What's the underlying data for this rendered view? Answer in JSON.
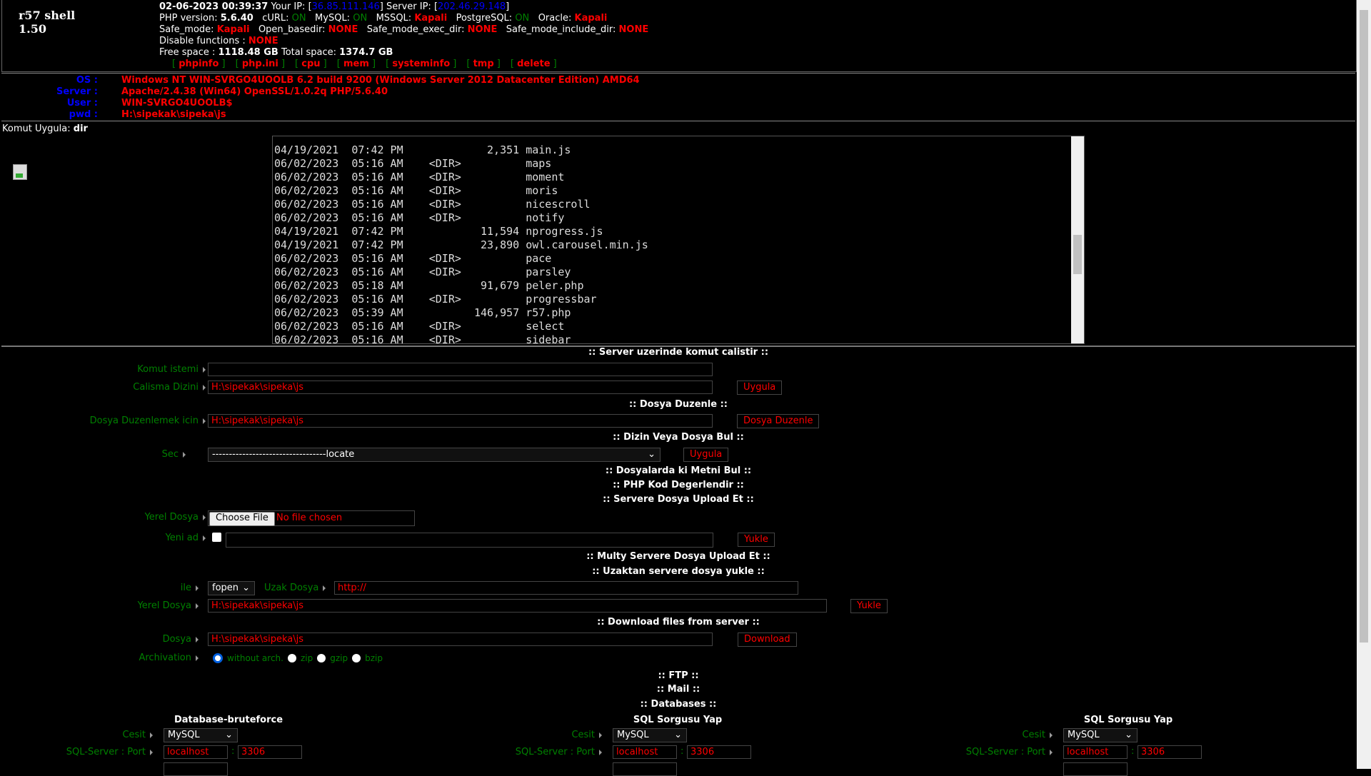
{
  "header": {
    "title": "r57 shell 1.50",
    "datetime": "02-06-2023 00:39:37",
    "your_ip_label": "Your IP:",
    "your_ip": "36.85.111.146",
    "server_ip_label": "Server IP:",
    "server_ip": "202.46.29.148",
    "php_version_label": "PHP version:",
    "php_version": "5.6.40",
    "curl_label": "cURL:",
    "curl": "ON",
    "mysql_label": "MySQL:",
    "mysql": "ON",
    "mssql_label": "MSSQL:",
    "mssql": "Kapali",
    "postgres_label": "PostgreSQL:",
    "postgres": "ON",
    "oracle_label": "Oracle:",
    "oracle": "Kapali",
    "safe_mode_label": "Safe_mode:",
    "safe_mode": "Kapali",
    "open_basedir_label": "Open_basedir:",
    "open_basedir": "NONE",
    "exec_dir_label": "Safe_mode_exec_dir:",
    "exec_dir": "NONE",
    "include_dir_label": "Safe_mode_include_dir:",
    "include_dir": "NONE",
    "disable_label": "Disable functions :",
    "disable": "NONE",
    "free_label": "Free space :",
    "free": "1118.48 GB",
    "total_label": "Total space:",
    "total": "1374.7 GB",
    "links": [
      "phpinfo",
      "php.ini",
      "cpu",
      "mem",
      "systeminfo",
      "tmp",
      "delete"
    ]
  },
  "system": {
    "os_label": "OS :",
    "os": "Windows NT WIN-SVRGO4UOOLB 6.2 build 9200 (Windows Server 2012 Datacenter Edition) AMD64",
    "server_label": "Server :",
    "server": "Apache/2.4.38 (Win64) OpenSSL/1.0.2q PHP/5.6.40",
    "user_label": "User :",
    "user": "WIN-SVRGO4UOOLB$",
    "pwd_label": "pwd :",
    "pwd": "H:\\sipekak\\sipeka\\js"
  },
  "command": {
    "label": "Komut Uygula:",
    "value": "dir"
  },
  "console": {
    "lines": [
      "04/19/2021  07:42 PM             2,351 main.js",
      "06/02/2023  05:16 AM    <DIR>          maps",
      "06/02/2023  05:16 AM    <DIR>          moment",
      "06/02/2023  05:16 AM    <DIR>          moris",
      "06/02/2023  05:16 AM    <DIR>          nicescroll",
      "06/02/2023  05:16 AM    <DIR>          notify",
      "04/19/2021  07:42 PM            11,594 nprogress.js",
      "04/19/2021  07:42 PM            23,890 owl.carousel.min.js",
      "06/02/2023  05:16 AM    <DIR>          pace",
      "06/02/2023  05:16 AM    <DIR>          parsley",
      "06/02/2023  05:18 AM            91,679 peler.php",
      "06/02/2023  05:16 AM    <DIR>          progressbar",
      "06/02/2023  05:39 AM           146,957 r57.php",
      "06/02/2023  05:16 AM    <DIR>          select",
      "06/02/2023  05:16 AM    <DIR>          sidebar"
    ]
  },
  "forms": {
    "exec_title": ":: Server uzerinde komut calistir ::",
    "komut_label": "Komut istemi",
    "komut_value": "",
    "dizin_label": "Calisma Dizini",
    "dizin_value": "H:\\sipekak\\sipeka\\js",
    "uygula": "Uygula",
    "edit_title": ":: Dosya Duzenle ::",
    "edit_label": "Dosya Duzenlemek icin",
    "edit_value": "H:\\sipekak\\sipeka\\js",
    "edit_button": "Dosya Duzenle",
    "find_title": ":: Dizin Veya Dosya Bul ::",
    "sec_label": "Sec",
    "sec_value": "----------------------------------locate",
    "text_title": ":: Dosyalarda ki Metni Bul ::",
    "php_title": ":: PHP Kod Degerlendir ::",
    "upload_title": ":: Servere Dosya Upload Et ::",
    "yerel_label": "Yerel Dosya",
    "choose_file": "Choose File",
    "no_file": "No file chosen",
    "yeni_label": "Yeni ad",
    "yeni_value": "",
    "yukle": "Yukle",
    "multi_title": ":: Multy Servere Dosya Upload Et ::",
    "remote_title": ":: Uzaktan servere dosya yukle ::",
    "ile_label": "ile",
    "ile_value": "fopen",
    "uzak_label": "Uzak Dosya",
    "uzak_value": "http://",
    "yerel2_label": "Yerel Dosya",
    "yerel2_value": "H:\\sipekak\\sipeka\\js",
    "download_title": ":: Download files from server ::",
    "dosya_label": "Dosya",
    "dosya_value": "H:\\sipekak\\sipeka\\js",
    "download": "Download",
    "arch_label": "Archivation",
    "arch_options": [
      "without arch.",
      "zip",
      "gzip",
      "bzip"
    ],
    "arch_selected": "without arch.",
    "ftp_title": ":: FTP ::",
    "mail_title": ":: Mail ::",
    "db_title": ":: Databases ::"
  },
  "databases": [
    {
      "title": "Database-bruteforce",
      "cesit_label": "Cesit",
      "cesit": "MySQL",
      "server_label": "SQL-Server : Port",
      "host": "localhost",
      "port": "3306"
    },
    {
      "title": "SQL Sorgusu Yap",
      "cesit_label": "Cesit",
      "cesit": "MySQL",
      "server_label": "SQL-Server : Port",
      "host": "localhost",
      "port": "3306"
    },
    {
      "title": "SQL Sorgusu Yap",
      "cesit_label": "Cesit",
      "cesit": "MySQL",
      "server_label": "SQL-Server : Port",
      "host": "localhost",
      "port": "3306"
    }
  ]
}
